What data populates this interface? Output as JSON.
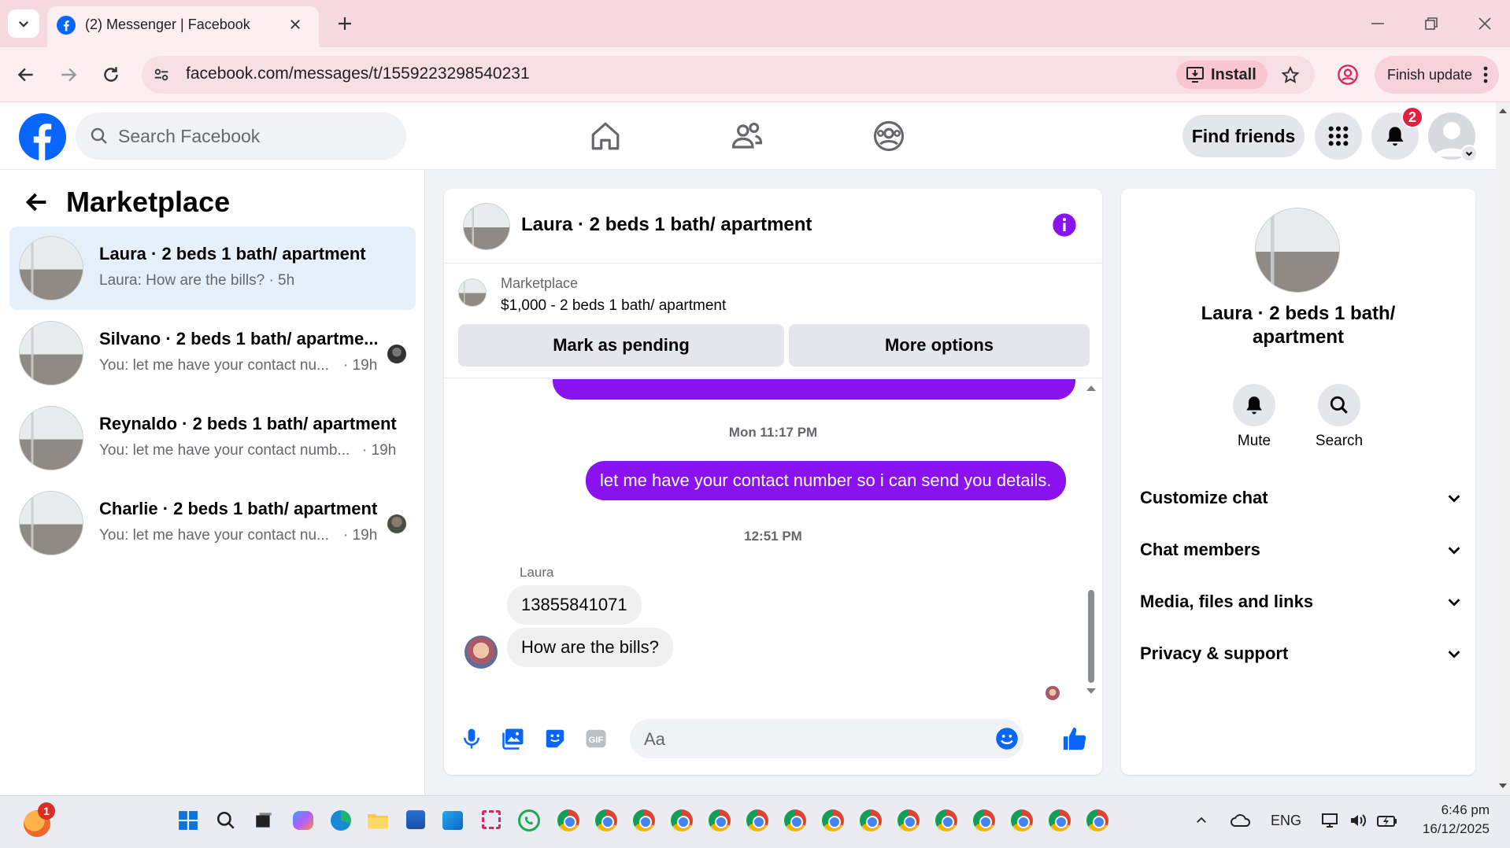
{
  "browser": {
    "tab_title": "(2) Messenger | Facebook",
    "url": "facebook.com/messages/t/1559223298540231",
    "install_label": "Install",
    "finish_update_label": "Finish update"
  },
  "fb_header": {
    "search_placeholder": "Search Facebook",
    "find_friends_label": "Find friends",
    "notification_count": "2",
    "accent_color": "#0866ff"
  },
  "left_panel": {
    "title": "Marketplace",
    "conversations": [
      {
        "title": "Laura · 2 beds 1 bath/ apartment",
        "preview": "Laura: How are the bills? · 5h",
        "active": true
      },
      {
        "title": "Silvano · 2 beds 1 bath/ apartme...",
        "preview": "You: let me have your contact nu...",
        "time": "· 19h"
      },
      {
        "title": "Reynaldo · 2 beds 1 bath/ apartment",
        "preview": "You: let me have your contact numb...",
        "time": "· 19h"
      },
      {
        "title": "Charlie · 2 beds 1 bath/ apartment",
        "preview": "You: let me have your contact nu...",
        "time": "· 19h"
      }
    ]
  },
  "chat": {
    "header_title": "Laura · 2 beds 1 bath/ apartment",
    "listing_source": "Marketplace",
    "listing_summary": "$1,000 - 2 beds 1 bath/ apartment",
    "mark_pending_label": "Mark as pending",
    "more_options_label": "More options",
    "timestamp_1": "Mon 11:17 PM",
    "outgoing_message": "let me have your contact number so i can send you details.",
    "timestamp_2": "12:51 PM",
    "sender_name": "Laura",
    "incoming_1": "13855841071",
    "incoming_2": "How are the bills?",
    "composer_placeholder": "Aa",
    "bubble_color": "#8a12f0"
  },
  "info_panel": {
    "name": "Laura · 2 beds 1 bath/ apartment",
    "mute_label": "Mute",
    "search_label": "Search",
    "sections": [
      "Customize chat",
      "Chat members",
      "Media, files and links",
      "Privacy & support"
    ]
  },
  "taskbar": {
    "notification_badge": "1",
    "language": "ENG",
    "time": "6:46 pm",
    "date": "16/12/2025"
  }
}
